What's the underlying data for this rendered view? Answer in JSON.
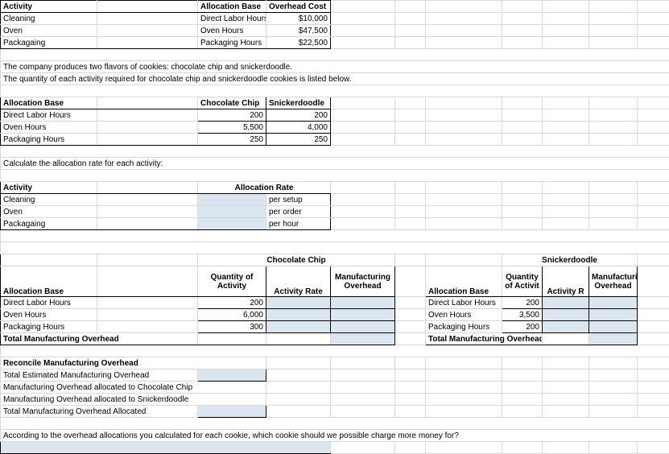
{
  "headers": {
    "activity": "Activity",
    "alloc_base": "Allocation Base",
    "overhead_cost": "Overhead Cost",
    "alloc_rate": "Allocation Rate",
    "choc_chip": "Chocolate Chip",
    "snicker": "Snickerdoodle",
    "qty_activity": "Quantity of Activity",
    "qty_activity_narrow": "Quantity of Activit",
    "activity_rate": "Activity Rate",
    "activity_rate_narrow": "Activity R",
    "mfg_overhead": "Manufacturing Overhead",
    "total_mfg": "Total Manufacturing Overhead",
    "reconcile": "Reconcile Manufacturing Overhead"
  },
  "table1": {
    "rows": [
      {
        "activity": "Cleaning",
        "base": "Direct Labor Hours",
        "cost": "$10,000"
      },
      {
        "activity": "Oven",
        "base": "Oven Hours",
        "cost": "$47,500"
      },
      {
        "activity": "Packagaing",
        "base": "Packaging Hours",
        "cost": "$22,500"
      }
    ]
  },
  "text": {
    "line1": "The company produces two flavors of cookies: chocolate chip and snickerdoodle.",
    "line2": "The quantity of each activity required for chocolate chip and snickerdoodle cookies is listed below.",
    "calc_rate": "Calculate the allocation rate for each activity:",
    "final_q": "According to the overhead allocations you calculated for each cookie, which cookie should we possible charge more money for?"
  },
  "table2": {
    "rows": [
      {
        "base": "Direct Labor Hours",
        "choc": "200",
        "snick": "200"
      },
      {
        "base": "Oven Hours",
        "choc": "5,500",
        "snick": "4,000"
      },
      {
        "base": "Packaging Hours",
        "choc": "250",
        "snick": "250"
      }
    ]
  },
  "table3": {
    "rows": [
      {
        "activity": "Cleaning",
        "per": "per setup"
      },
      {
        "activity": "Oven",
        "per": "per order"
      },
      {
        "activity": "Packagaing",
        "per": "per hour"
      }
    ]
  },
  "choc_table": {
    "rows": [
      {
        "base": "Direct Labor Hours",
        "qty": "200"
      },
      {
        "base": "Oven Hours",
        "qty": "6,000"
      },
      {
        "base": "Packaging Hours",
        "qty": "300"
      }
    ]
  },
  "snick_table": {
    "rows": [
      {
        "base": "Direct Labor Hours",
        "qty": "200"
      },
      {
        "base": "Oven Hours",
        "qty": "3,500"
      },
      {
        "base": "Packaging Hours",
        "qty": "200"
      }
    ]
  },
  "reconcile": {
    "r1": "Total Estimated Manufacturing Overhead",
    "r2": "Manufacturing Overhead allocated to Chocolate Chip",
    "r3": "Manufacturing Overhead allocated to Snickerdoodle",
    "r4": "Total Manufacturing Overhead Allocated"
  }
}
